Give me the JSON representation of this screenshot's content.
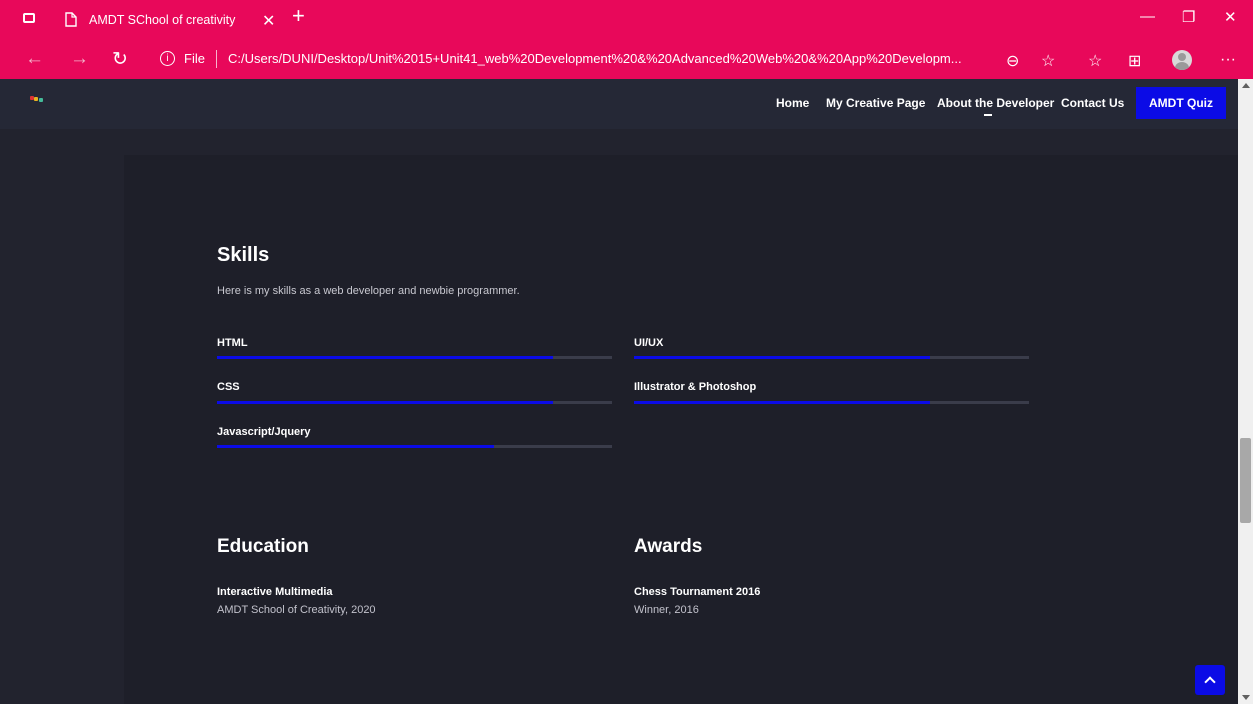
{
  "browser": {
    "tab_title": "AMDT SChool of creativity",
    "tab_close": "✕",
    "new_tab": "+",
    "address_prefix": "File",
    "address_url": "C:/Users/DUNI/Desktop/Unit%2015+Unit41_web%20Development%20&%20Advanced%20Web%20&%20App%20Developm...",
    "controls": {
      "minimize": "—",
      "restore": "❐",
      "close": "✕"
    },
    "nav": {
      "back": "←",
      "forward": "→",
      "refresh": "↻"
    },
    "icons": {
      "zoom": "⊖",
      "add_favorite": "☆",
      "favorites": "☆",
      "collections": "⊞",
      "more": "···"
    }
  },
  "site": {
    "menu": [
      "Home",
      "My Creative Page",
      "About the Developer",
      "Contact Us"
    ],
    "cta": "AMDT Quiz",
    "accent_color": "#0b0be6"
  },
  "skills": {
    "heading": "Skills",
    "intro": "Here is my skills as a web developer and newbie programmer.",
    "items": [
      {
        "label": "HTML",
        "level": 0.85
      },
      {
        "label": "UI/UX",
        "level": 0.75
      },
      {
        "label": "CSS",
        "level": 0.85
      },
      {
        "label": "Illustrator & Photoshop",
        "level": 0.75
      },
      {
        "label": "Javascript/Jquery",
        "level": 0.7
      }
    ]
  },
  "education": {
    "heading": "Education",
    "title": "Interactive Multimedia",
    "detail": "AMDT School of Creativity, 2020"
  },
  "awards": {
    "heading": "Awards",
    "title": "Chess Tournament 2016",
    "detail": "Winner, 2016"
  }
}
